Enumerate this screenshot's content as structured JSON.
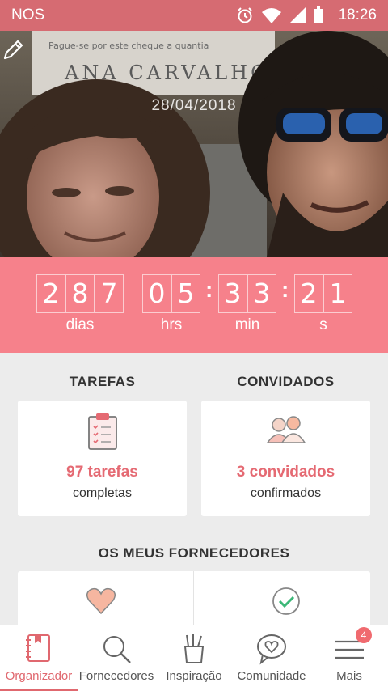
{
  "status_bar": {
    "carrier": "NOS",
    "time": "18:26"
  },
  "hero": {
    "date": "28/04/2018",
    "sign_text": "Pague-se por este cheque a quantia",
    "sign_name": "ANA CARVALHO"
  },
  "countdown": {
    "days": [
      "2",
      "8",
      "7"
    ],
    "hours": [
      "0",
      "5"
    ],
    "minutes": [
      "3",
      "3"
    ],
    "seconds": [
      "2",
      "1"
    ],
    "labels": {
      "days": "dias",
      "hours": "hrs",
      "minutes": "min",
      "seconds": "s"
    }
  },
  "tasks": {
    "title": "TAREFAS",
    "count": "97 tarefas",
    "caption": "completas"
  },
  "guests": {
    "title": "CONVIDADOS",
    "count": "3 convidados",
    "caption": "confirmados"
  },
  "suppliers": {
    "title": "OS MEUS FORNECEDORES"
  },
  "nav": {
    "items": [
      {
        "label": "Organizador",
        "icon": "notebook-icon"
      },
      {
        "label": "Fornecedores",
        "icon": "search-icon"
      },
      {
        "label": "Inspiração",
        "icon": "pencil-cup-icon"
      },
      {
        "label": "Comunidade",
        "icon": "chat-heart-icon"
      },
      {
        "label": "Mais",
        "icon": "menu-icon",
        "badge": "4"
      }
    ]
  },
  "colors": {
    "accent": "#f6818b",
    "accent_dark": "#e0686f",
    "status_bar": "#d66b72"
  }
}
